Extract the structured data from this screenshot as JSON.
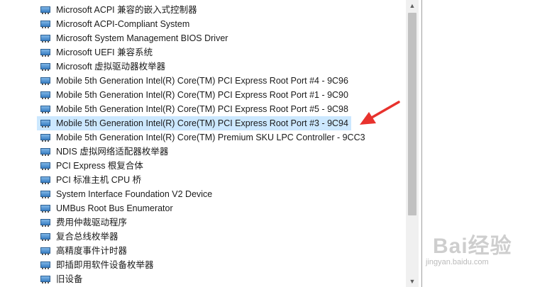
{
  "device_list": [
    "Microsoft ACPI 兼容的嵌入式控制器",
    "Microsoft ACPI-Compliant System",
    "Microsoft System Management BIOS Driver",
    "Microsoft UEFI 兼容系统",
    "Microsoft 虚拟驱动器枚举器",
    "Mobile 5th Generation Intel(R) Core(TM) PCI Express Root Port #4 - 9C96",
    "Mobile 5th Generation Intel(R) Core(TM) PCI Express Root Port #1 - 9C90",
    "Mobile 5th Generation Intel(R) Core(TM) PCI Express Root Port #5 - 9C98",
    "Mobile 5th Generation Intel(R) Core(TM) PCI Express Root Port #3 - 9C94",
    "Mobile 5th Generation Intel(R) Core(TM) Premium SKU LPC Controller - 9CC3",
    "NDIS 虚拟网络适配器枚举器",
    "PCI Express 根复合体",
    "PCI 标准主机 CPU 桥",
    "System Interface Foundation V2 Device",
    "UMBus Root Bus Enumerator",
    "费用仲裁驱动程序",
    "复合总线枚举器",
    "高精度事件计时器",
    "即插即用软件设备枚举器",
    "旧设备"
  ],
  "selected_index": 8,
  "scrollbar": {
    "up_icon": "▲",
    "down_icon": "▼"
  },
  "watermark": {
    "brand": "Bai经验",
    "url": "jingyan.baidu.com"
  },
  "colors": {
    "selection": "#cce8ff",
    "arrow": "#e8322d"
  }
}
